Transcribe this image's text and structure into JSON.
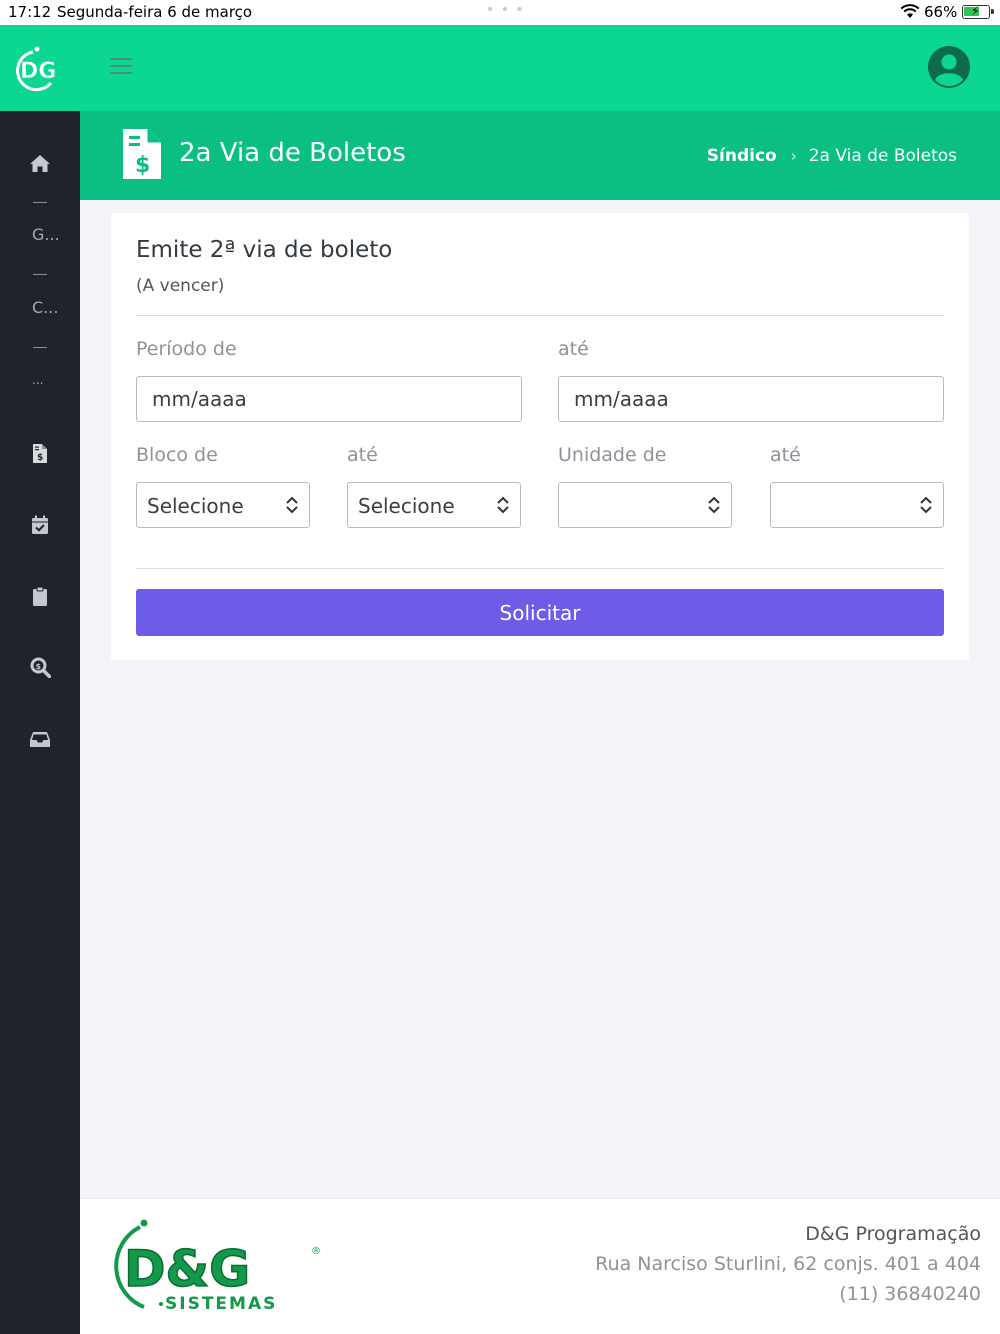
{
  "status_bar": {
    "time": "17:12",
    "date": "Segunda-feira 6 de março",
    "battery": "66%",
    "battery_level": 0.66
  },
  "header": {
    "logo_text": "DG",
    "icons": [
      "hamburger-icon",
      "user-avatar-icon"
    ]
  },
  "sidebar": {
    "items": [
      {
        "icon": "home-icon"
      },
      {
        "label": "G..."
      },
      {
        "label": "C..."
      },
      {
        "label": "..."
      },
      {
        "icon": "invoice-icon"
      },
      {
        "icon": "calendar-check-icon"
      },
      {
        "icon": "clipboard-icon"
      },
      {
        "icon": "search-dollar-icon"
      },
      {
        "icon": "inbox-icon"
      }
    ]
  },
  "page_header": {
    "title": "2a Via de Boletos",
    "breadcrumb": [
      "Síndico",
      "2a Via de Boletos"
    ]
  },
  "form": {
    "title": "Emite 2ª via de boleto",
    "subtitle": "(A vencer)",
    "periodo_de_label": "Período de",
    "periodo_ate_label": "até",
    "periodo_de_placeholder": "mm/aaaa",
    "periodo_ate_placeholder": "mm/aaaa",
    "bloco_de_label": "Bloco de",
    "bloco_ate_label": "até",
    "unidade_de_label": "Unidade de",
    "unidade_ate_label": "até",
    "bloco_de_value": "Selecione",
    "bloco_ate_value": "Selecione",
    "unidade_de_value": "",
    "unidade_ate_value": "",
    "submit_label": "Solicitar"
  },
  "footer": {
    "logo_text": "D&G",
    "logo_sub": "SISTEMAS",
    "company": "D&G Programação",
    "address": "Rua Narciso Sturlini, 62 conjs. 401 a 404",
    "phone": "(11) 36840240"
  },
  "colors": {
    "brand_green": "#0bd793",
    "header_green": "#0bbf84",
    "sidebar": "#20232a",
    "button_purple": "#6c5ce7"
  }
}
